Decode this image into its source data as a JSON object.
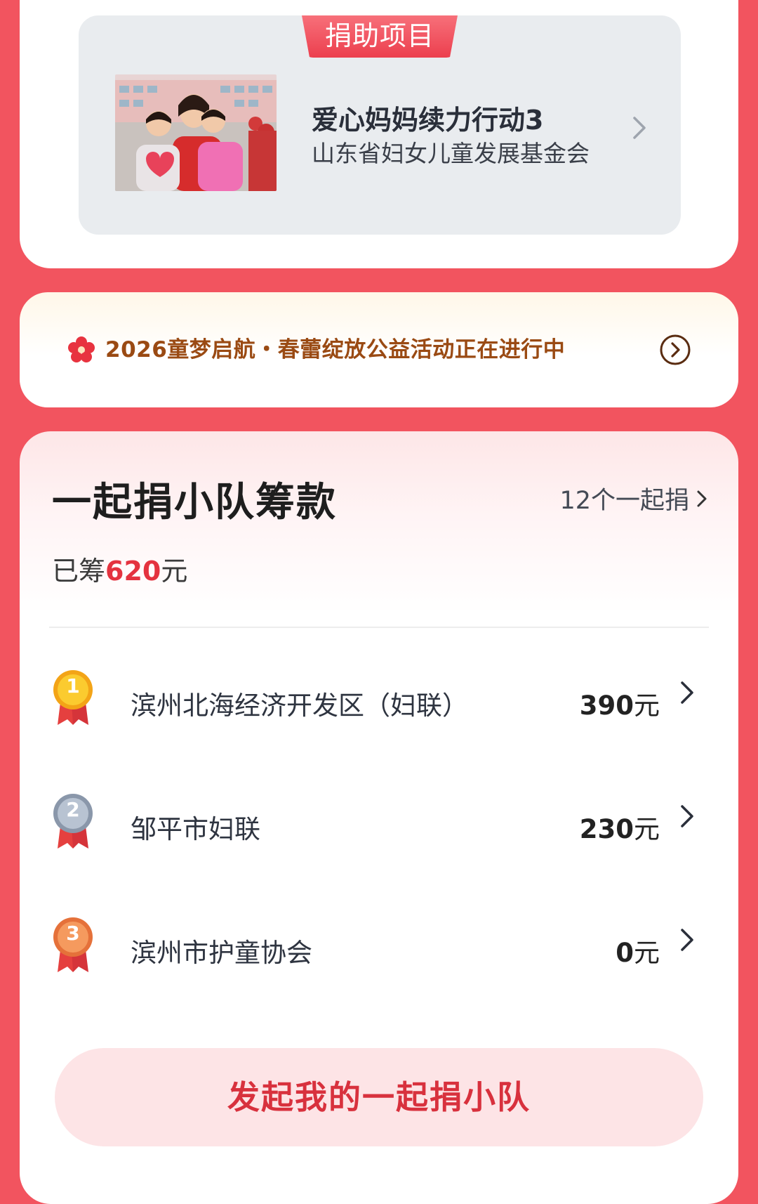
{
  "project": {
    "tag": "捐助项目",
    "title": "爱心妈妈续力行动3",
    "organization": "山东省妇女儿童发展基金会",
    "photo_desc_icon": "children-hugging-photo"
  },
  "banner": {
    "text": "2026童梦启航・春蕾绽放公益活动正在进行中",
    "icon": "flower-icon",
    "arrow_icon": "circle-arrow-right-icon"
  },
  "team": {
    "title": "一起捐小队筹款",
    "count_link": "12个一起捐",
    "raised_prefix": "已筹",
    "raised_amount": "620",
    "raised_unit": "元",
    "rows": [
      {
        "rank": "1",
        "name": "滨州北海经济开发区（妇联）",
        "amount": "390",
        "unit": "元",
        "medal_color": "#F5B72A"
      },
      {
        "rank": "2",
        "name": "邹平市妇联",
        "amount": "230",
        "unit": "元",
        "medal_color": "#9AA6B8"
      },
      {
        "rank": "3",
        "name": "滨州市护童协会",
        "amount": "0",
        "unit": "元",
        "medal_color": "#F0874E"
      }
    ],
    "start_button": "发起我的一起捐小队"
  },
  "colors": {
    "background": "#F2545F",
    "accent": "#E4333F",
    "banner_text": "#9A4A13"
  }
}
